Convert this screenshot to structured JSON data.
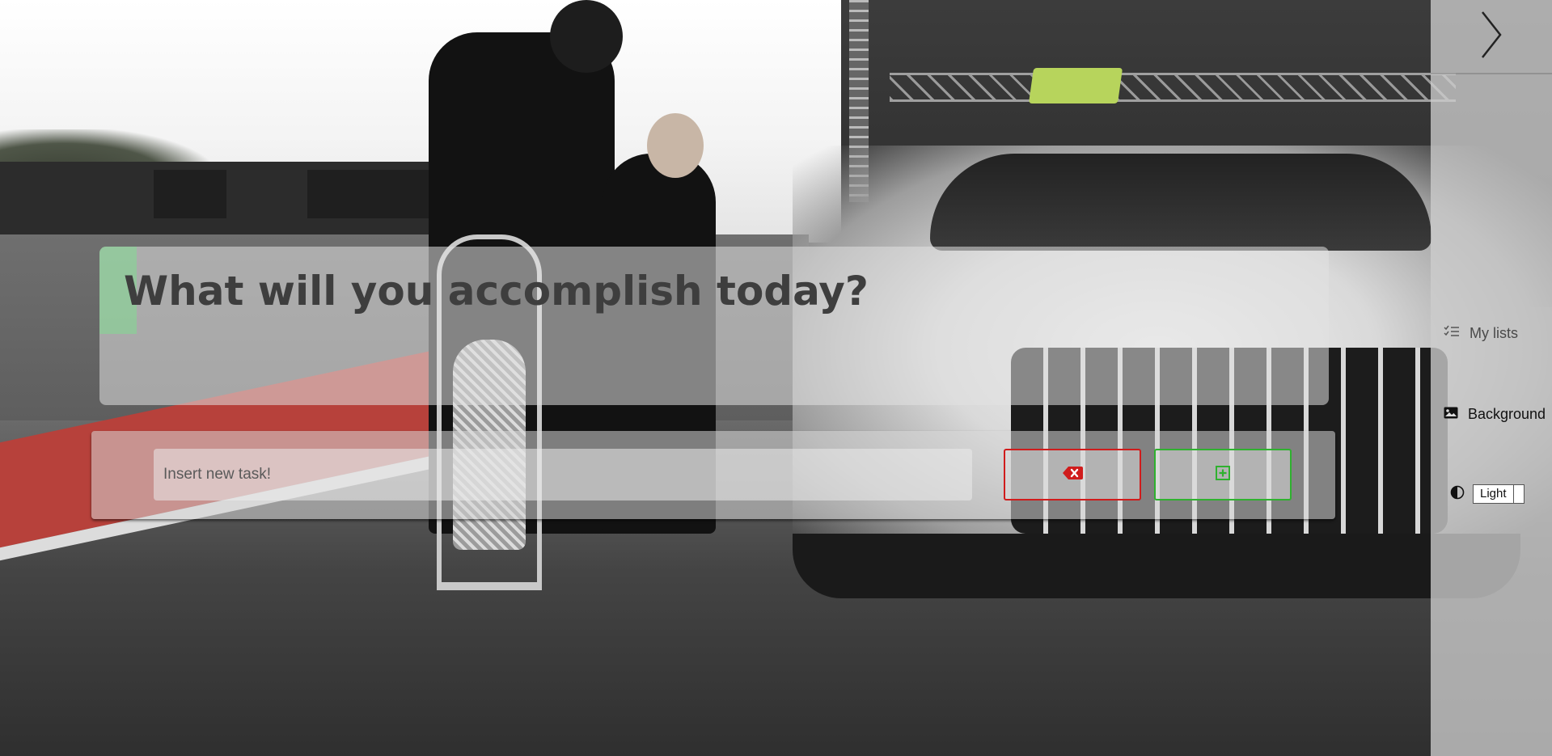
{
  "main": {
    "greeting": "What will you accomplish today?",
    "task_input": {
      "placeholder": "Insert new task!",
      "value": ""
    },
    "clear_button": {
      "icon": "backspace-x-icon",
      "color": "#d01c1c"
    },
    "add_button": {
      "icon": "plus-square-icon",
      "color": "#2fb12f"
    }
  },
  "sidebar": {
    "toggle_icon": "chevron-right-icon",
    "my_lists_label": "My lists",
    "background_label": "Background",
    "theme": {
      "icon": "contrast-icon",
      "selected": "Light"
    }
  }
}
